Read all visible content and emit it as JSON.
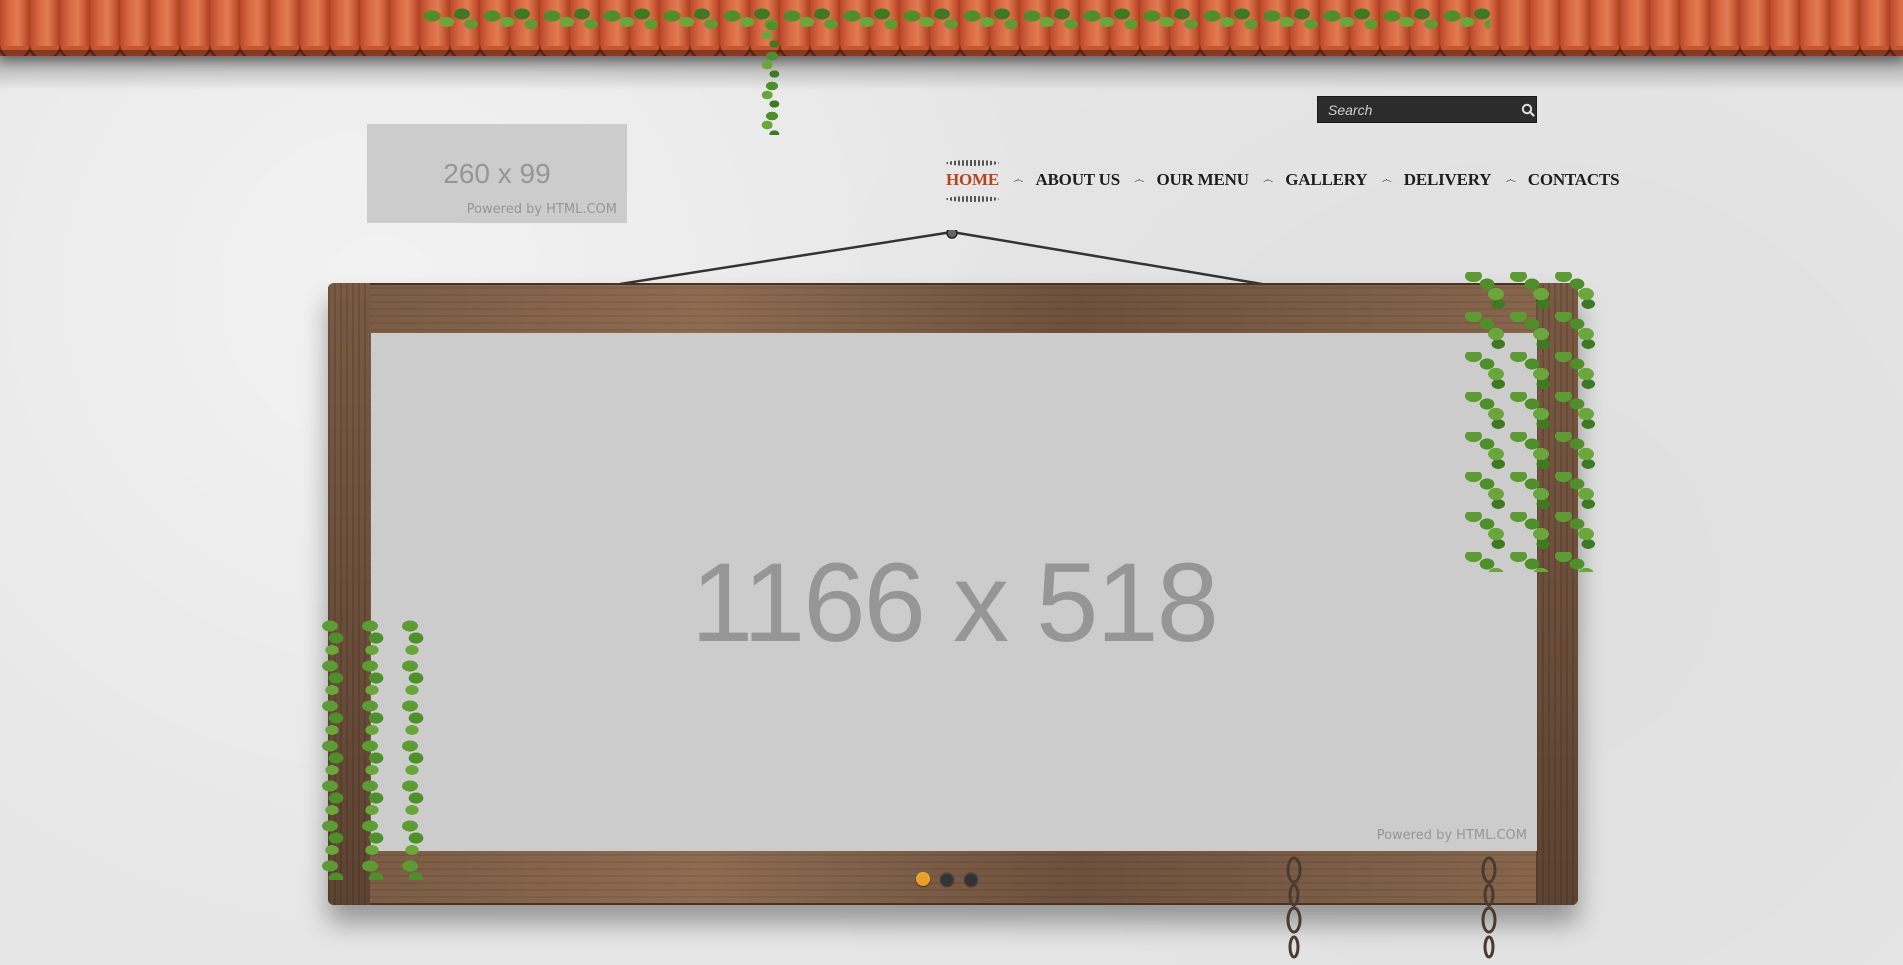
{
  "search": {
    "placeholder": "Search",
    "value": ""
  },
  "logo": {
    "dimensions": "260 x 99",
    "powered": "Powered by HTML.COM"
  },
  "nav": {
    "items": [
      {
        "label": "HOME",
        "active": true
      },
      {
        "label": "ABOUT US"
      },
      {
        "label": "OUR MENU"
      },
      {
        "label": "GALLERY"
      },
      {
        "label": "DELIVERY"
      },
      {
        "label": "CONTACTS"
      }
    ],
    "separator": "෴"
  },
  "slider": {
    "dimensions": "1166 x 518",
    "powered": "Powered by HTML.COM",
    "active_index": 0,
    "slide_count": 3
  },
  "colors": {
    "nav_active": "#b5431c",
    "dot_active": "#e7a021",
    "placeholder_bg": "#cccccc"
  },
  "icons": [
    "search-icon",
    "ivy-decoration",
    "wooden-frame",
    "chain-decoration"
  ]
}
